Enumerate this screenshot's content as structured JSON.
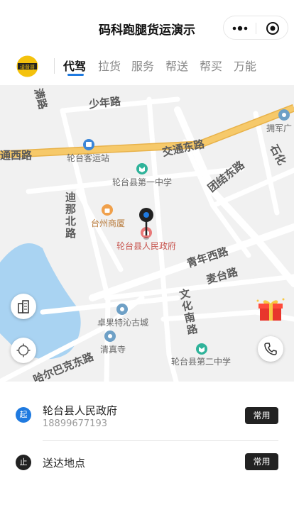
{
  "app": {
    "title": "码科跑腿货运演示",
    "logo_text": "请晋哥"
  },
  "tabs": [
    {
      "label": "代驾",
      "active": true
    },
    {
      "label": "拉货",
      "active": false
    },
    {
      "label": "服务",
      "active": false
    },
    {
      "label": "帮送",
      "active": false
    },
    {
      "label": "帮买",
      "active": false
    },
    {
      "label": "万能",
      "active": false
    }
  ],
  "map": {
    "roads": {
      "jiaotong_west": "通西路",
      "jiaotong_east": "交通东路",
      "shaonian": "少年路",
      "tuanjie_east": "团结东路",
      "dina_north": "迪那北路",
      "qingnian_west": "青年西路",
      "maitai": "麦台路",
      "wenhua_south": "文化南路",
      "haerbakeshi_east": "哈尔巴克东路",
      "top_left": "满路",
      "right_edge": "石化"
    },
    "pois": {
      "bus_station": "轮台客运站",
      "school_1": "轮台县第一中学",
      "mall": "台州商厦",
      "gov": "轮台县人民政府",
      "zhuoguo_city": "卓果特沁古城",
      "mosque": "清真寺",
      "school_2": "轮台县第二中学",
      "top_right": "拥军广"
    },
    "icons": {
      "building_button": "building-icon",
      "locate_button": "locate-icon",
      "phone_button": "phone-icon",
      "gift": "gift-icon",
      "center_pin": "location-pin-icon"
    }
  },
  "route": {
    "start": {
      "badge": "起",
      "name": "轮台县人民政府",
      "phone": "18899677193",
      "button": "常用"
    },
    "end": {
      "badge": "止",
      "name": "送达地点",
      "button": "常用"
    }
  },
  "colors": {
    "accent_blue": "#1f7ae0",
    "main_road": "#f6c96a",
    "water": "#a9d3f2",
    "gov_red": "#e87878"
  }
}
